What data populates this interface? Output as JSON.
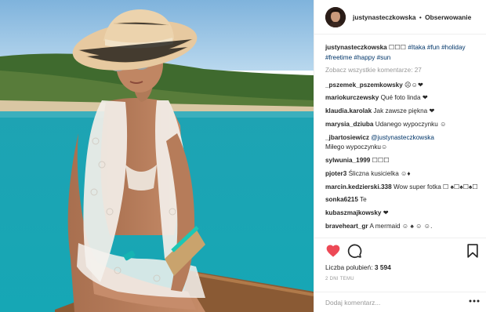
{
  "photo": {
    "alt_icon": "post-photo"
  },
  "header": {
    "username": "justynasteczkowska",
    "separator": "•",
    "follow_label": "Obserwowanie"
  },
  "caption": {
    "username": "justynasteczkowska",
    "text": " ☐☐☐ ",
    "tags": [
      "#Itaka",
      "#fun",
      "#holiday",
      "#freetime",
      "#happy",
      "#sun"
    ]
  },
  "view_all_comments": "Zobacz wszystkie komentarze: 27",
  "comments": [
    {
      "user": "_pszemek_pszemkowsky",
      "text": "☹☺❤"
    },
    {
      "user": "mariokurczewsky",
      "text": "Qué foto linda ❤"
    },
    {
      "user": "klaudia.karolak",
      "text": "Jak zawsze piękna ❤"
    },
    {
      "user": "marysia_dziuba",
      "text": "Udanego wypoczynku ☺"
    },
    {
      "user": "_jbartosiewicz",
      "mention": "@justynasteczkowska",
      "text": "Miłego wypoczynku☺"
    },
    {
      "user": "sylwunia_1999",
      "text": "☐☐☐"
    },
    {
      "user": "pjoter3",
      "text": "Śliczna kusicielka ☺♦"
    },
    {
      "user": "marcin.kedzierski.338",
      "text": "Wow super fotka ☐ ♠☐♠☐♠☐"
    },
    {
      "user": "sonka6215",
      "text": "Te"
    },
    {
      "user": "kubaszmajkowsky",
      "text": "❤"
    },
    {
      "user": "braveheart_gr",
      "text": "A mermaid ☺ ♠ ☺ ☺."
    }
  ],
  "actions": {
    "like_icon": "heart-icon",
    "comment_icon": "comment-icon",
    "save_icon": "bookmark-icon",
    "like_color": "#ed4956"
  },
  "likes": {
    "label": "Liczba polubień:",
    "count": "3 594"
  },
  "time_ago": "2 DNI TEMU",
  "add_comment": {
    "placeholder": "Dodaj komentarz...",
    "more_icon": "more-options-icon"
  }
}
